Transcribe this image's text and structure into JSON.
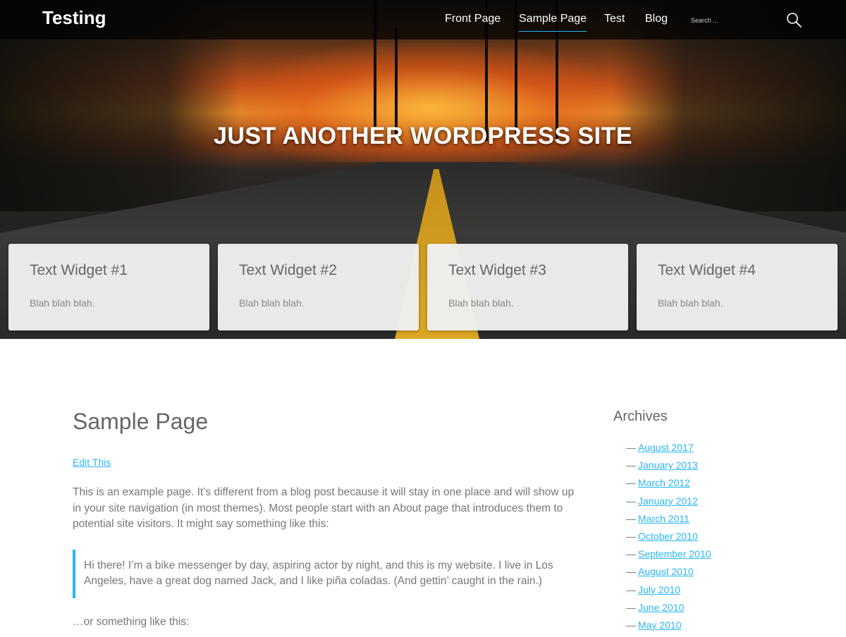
{
  "header": {
    "site_title": "Testing",
    "nav": [
      {
        "label": "Front Page",
        "active": false
      },
      {
        "label": "Sample Page",
        "active": true
      },
      {
        "label": "Test",
        "active": false
      },
      {
        "label": "Blog",
        "active": false
      }
    ],
    "search_placeholder": "Search ...",
    "search_icon": "search-icon"
  },
  "hero": {
    "tagline": "JUST ANOTHER WORDPRESS SITE"
  },
  "widgets": [
    {
      "title": "Text Widget #1",
      "text": "Blah blah blah."
    },
    {
      "title": "Text Widget #2",
      "text": "Blah blah blah."
    },
    {
      "title": "Text Widget #3",
      "text": "Blah blah blah."
    },
    {
      "title": "Text Widget #4",
      "text": "Blah blah blah."
    }
  ],
  "main": {
    "title": "Sample Page",
    "edit_link": "Edit This",
    "intro": "This is an example page. It’s different from a blog post because it will stay in one place and will show up in your site navigation (in most themes). Most people start with an About page that introduces them to potential site visitors. It might say something like this:",
    "quote": "Hi there! I’m a bike messenger by day, aspiring actor by night, and this is my website. I live in Los Angeles, have a great dog named Jack, and I like piña coladas. (And gettin’ caught in the rain.)",
    "outro": "…or something like this:"
  },
  "sidebar": {
    "title": "Archives",
    "dash": "—",
    "items": [
      "August 2017",
      "January 2013",
      "March 2012",
      "January 2012",
      "March 2011",
      "October 2010",
      "September 2010",
      "August 2010",
      "July 2010",
      "June 2010",
      "May 2010"
    ]
  },
  "colors": {
    "accent": "#29b6f6",
    "text": "#666666",
    "widget_bg": "#f0f0f0"
  }
}
